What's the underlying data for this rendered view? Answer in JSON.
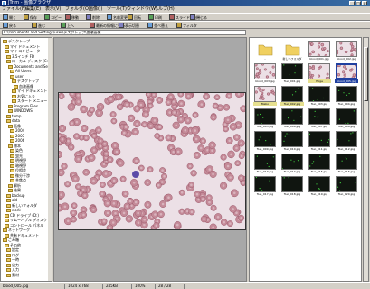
{
  "window": {
    "title": "JTrim - 画像ブラウザ"
  },
  "menu": [
    "ファイル(F)",
    "編集(E)",
    "表示(V)",
    "フォルダ(O)",
    "画像(I)",
    "ツール(T)",
    "ウィンドウ(W)",
    "ヘルプ(H)"
  ],
  "toolbar1": [
    {
      "icon": "open-icon",
      "label": "開く"
    },
    {
      "icon": "save-icon",
      "label": "保存"
    },
    {
      "icon": "copy-icon",
      "label": "コピー"
    },
    {
      "icon": "move-icon",
      "label": "移動"
    },
    {
      "icon": "delete-icon",
      "label": "削除"
    },
    {
      "icon": "rename-icon",
      "label": "名前変更"
    },
    {
      "icon": "rotate-icon",
      "label": "回転"
    },
    {
      "icon": "print-icon",
      "label": "印刷"
    },
    {
      "icon": "slideshow-icon",
      "label": "スライドショー"
    },
    {
      "icon": "close-icon",
      "label": "閉じる"
    }
  ],
  "toolbar2": [
    {
      "icon": "back-icon",
      "label": "戻る"
    },
    {
      "icon": "forward-icon",
      "label": "進む"
    },
    {
      "icon": "up-icon",
      "label": "上へ"
    },
    {
      "icon": "refresh-icon",
      "label": "最新の情報に更新"
    },
    {
      "icon": "view-icon",
      "label": "表示切替"
    },
    {
      "icon": "sort-icon",
      "label": "並べ替え"
    },
    {
      "icon": "filter-icon",
      "label": "フィルタ"
    }
  ],
  "address": {
    "value": "C:\\Documents and Settings\\user\\デスクトップ\\血液画像"
  },
  "tree": [
    "デスクトップ",
    "マイ ドキュメント",
    "マイ コンピュータ",
    "3.5インチ FD",
    "ローカル ディスク (C:)",
    "Documents and Settings",
    "All Users",
    "user",
    "デスクトップ",
    "血液画像",
    "マイ ドキュメント",
    "お気に入り",
    "スタート メニュー",
    "Program Files",
    "WINDOWS",
    "temp",
    "data",
    "画像",
    "2004",
    "2005",
    "2006",
    "標本",
    "染色",
    "蛍光",
    "明視野",
    "暗視野",
    "位相差",
    "微分干渉",
    "共焦点",
    "解析",
    "結果",
    "backup",
    "old",
    "新しいフォルダ",
    "work",
    "CD ドライブ (D:)",
    "リムーバブル ディスク (E:)",
    "コントロール パネル",
    "ネットワーク",
    "共有ドキュメント",
    "ごみ箱",
    "その他",
    "設定",
    "ログ",
    "一時",
    "出力",
    "入力",
    "素材"
  ],
  "thumbnails": [
    {
      "name": "..",
      "kind": "folder"
    },
    {
      "name": "新しいフォルダ",
      "kind": "folder"
    },
    {
      "name": "blood_001.jpg",
      "kind": "blood"
    },
    {
      "name": "blood_002.jpg",
      "kind": "blood"
    },
    {
      "name": "blood_003.jpg",
      "kind": "blood"
    },
    {
      "name": "fluo_001.jpg",
      "kind": "dark"
    },
    {
      "name": "Hoge",
      "kind": "blood",
      "tag": "tagged"
    },
    {
      "name": "blood_005.jpg",
      "kind": "blood",
      "tag": "selected"
    },
    {
      "name": "Mebo",
      "kind": "blood",
      "tag": "tagged"
    },
    {
      "name": "fluo_002.jpg",
      "kind": "dark",
      "tag": "tagged"
    },
    {
      "name": "fluo_003.jpg",
      "kind": "dark"
    },
    {
      "name": "fluo_004.jpg",
      "kind": "dark"
    },
    {
      "name": "fluo_005.jpg",
      "kind": "dark"
    },
    {
      "name": "fluo_006.jpg",
      "kind": "dark"
    },
    {
      "name": "fluo_007.jpg",
      "kind": "dark"
    },
    {
      "name": "fluo_008.jpg",
      "kind": "dark"
    },
    {
      "name": "fluo_009.jpg",
      "kind": "dark"
    },
    {
      "name": "fluo_010.jpg",
      "kind": "dark"
    },
    {
      "name": "fluo_011.jpg",
      "kind": "dark"
    },
    {
      "name": "fluo_012.jpg",
      "kind": "dark"
    },
    {
      "name": "fluo_013.jpg",
      "kind": "dark"
    },
    {
      "name": "fluo_014.jpg",
      "kind": "dark"
    },
    {
      "name": "fluo_015.jpg",
      "kind": "dark"
    },
    {
      "name": "fluo_016.jpg",
      "kind": "dark"
    },
    {
      "name": "fluo_017.jpg",
      "kind": "dark"
    },
    {
      "name": "fluo_018.jpg",
      "kind": "dark"
    },
    {
      "name": "fluo_019.jpg",
      "kind": "dark"
    },
    {
      "name": "fluo_020.jpg",
      "kind": "dark"
    }
  ],
  "status": {
    "filename": "blood_005.jpg",
    "size": "1024 x 768",
    "filesize": "245KB",
    "zoom": "100%",
    "count": "28 / 28"
  },
  "colors": {
    "rbc_fill": "#c48a98",
    "rbc_edge": "#9c5a6c",
    "rbc_center": "#d9b3bd",
    "slide_bg": "#ece0e6",
    "wbc": "#5a4aa8",
    "fluo_bg": "#101510",
    "fluo_dot": "#40d040"
  }
}
